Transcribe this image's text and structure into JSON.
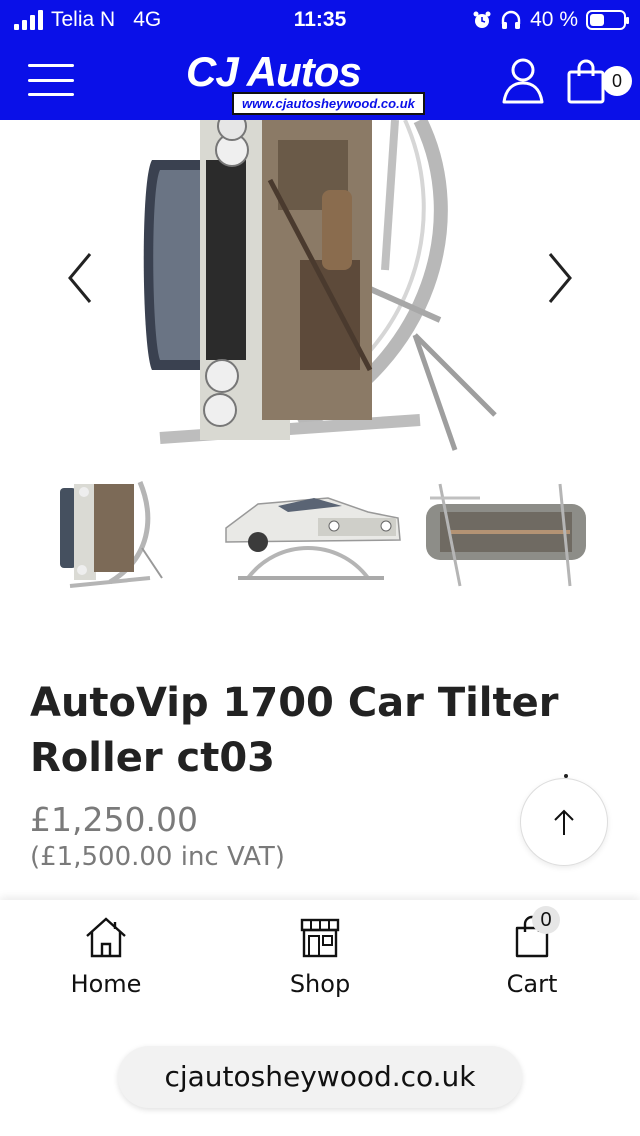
{
  "status_bar": {
    "carrier": "Telia N",
    "network": "4G",
    "time": "11:35",
    "battery": "40 %"
  },
  "header": {
    "logo_text": "CJ Autos",
    "logo_url": "www.cjautosheywood.co.uk",
    "cart_count": "0",
    "icons": [
      "menu-icon",
      "user-icon",
      "bag-icon"
    ]
  },
  "gallery": {
    "prev_icon": "chevron-left-icon",
    "next_icon": "chevron-right-icon",
    "thumbnail_count": 3
  },
  "product": {
    "title": "AutoVip 1700 Car Tilter Roller ct03",
    "price": "£1,250.00",
    "price_inc_vat": "(£1,500.00 inc VAT)"
  },
  "back_to_top_icon": "arrow-up-icon",
  "bottom_nav": {
    "items": [
      {
        "label": "Home",
        "icon": "home-icon"
      },
      {
        "label": "Shop",
        "icon": "store-icon"
      },
      {
        "label": "Cart",
        "icon": "bag-icon"
      }
    ],
    "cart_badge": "0"
  },
  "browser": {
    "url": "cjautosheywood.co.uk"
  },
  "colors": {
    "brand_blue": "#0a10e8",
    "price_grey": "#7a7a7a"
  }
}
